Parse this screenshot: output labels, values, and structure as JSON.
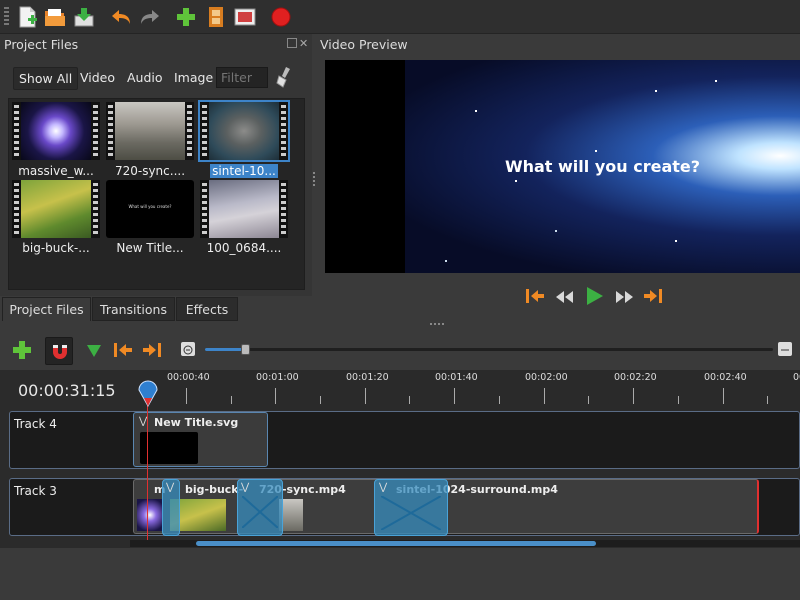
{
  "toolbar": {
    "icons": [
      "new-project-icon",
      "open-project-icon",
      "save-project-icon",
      "undo-icon",
      "redo-icon",
      "import-files-icon",
      "choose-profile-icon",
      "fullscreen-icon",
      "export-video-icon"
    ]
  },
  "project_files": {
    "title": "Project Files",
    "filters": [
      "Show All",
      "Video",
      "Audio",
      "Image"
    ],
    "filter_placeholder": "Filter",
    "files": [
      {
        "name": "massive_w..."
      },
      {
        "name": "720-sync...."
      },
      {
        "name": "sintel-10..."
      },
      {
        "name": "big-buck-..."
      },
      {
        "name": "New Title..."
      },
      {
        "name": "100_0684...."
      }
    ],
    "selected_index": 2
  },
  "tabs": [
    "Project Files",
    "Transitions",
    "Effects"
  ],
  "preview": {
    "title": "Video Preview",
    "overlay_text": "What will you create?",
    "thumb_overlay_text": "What will you create?"
  },
  "timeline": {
    "timecode": "00:00:31:15",
    "ruler_labels": [
      "00:00:40",
      "00:01:00",
      "00:01:20",
      "00:01:40",
      "00:02:00",
      "00:02:20",
      "00:02:40"
    ],
    "tracks": [
      {
        "name": "Track 4",
        "clips": [
          {
            "title": "New Title.svg"
          }
        ]
      },
      {
        "name": "Track 3",
        "clips": [
          {
            "title": "m"
          },
          {
            "title": "big-buck-"
          },
          {
            "title": "720-sync.mp4"
          },
          {
            "title": "sintel-1024-surround.mp4"
          }
        ]
      }
    ],
    "zoom_level": 0.25
  },
  "colors": {
    "accent": "#3d84c9",
    "playhead": "#e03030",
    "play_green": "#3cb043",
    "nav_orange": "#f08a24"
  }
}
